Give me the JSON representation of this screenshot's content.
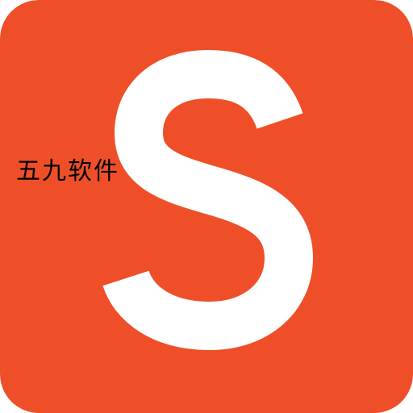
{
  "icon": {
    "background_color": "#EF4F28",
    "letter": "S",
    "letter_color": "#FFFFFF"
  },
  "watermark": {
    "text": "五九软件",
    "color": "#000000"
  }
}
